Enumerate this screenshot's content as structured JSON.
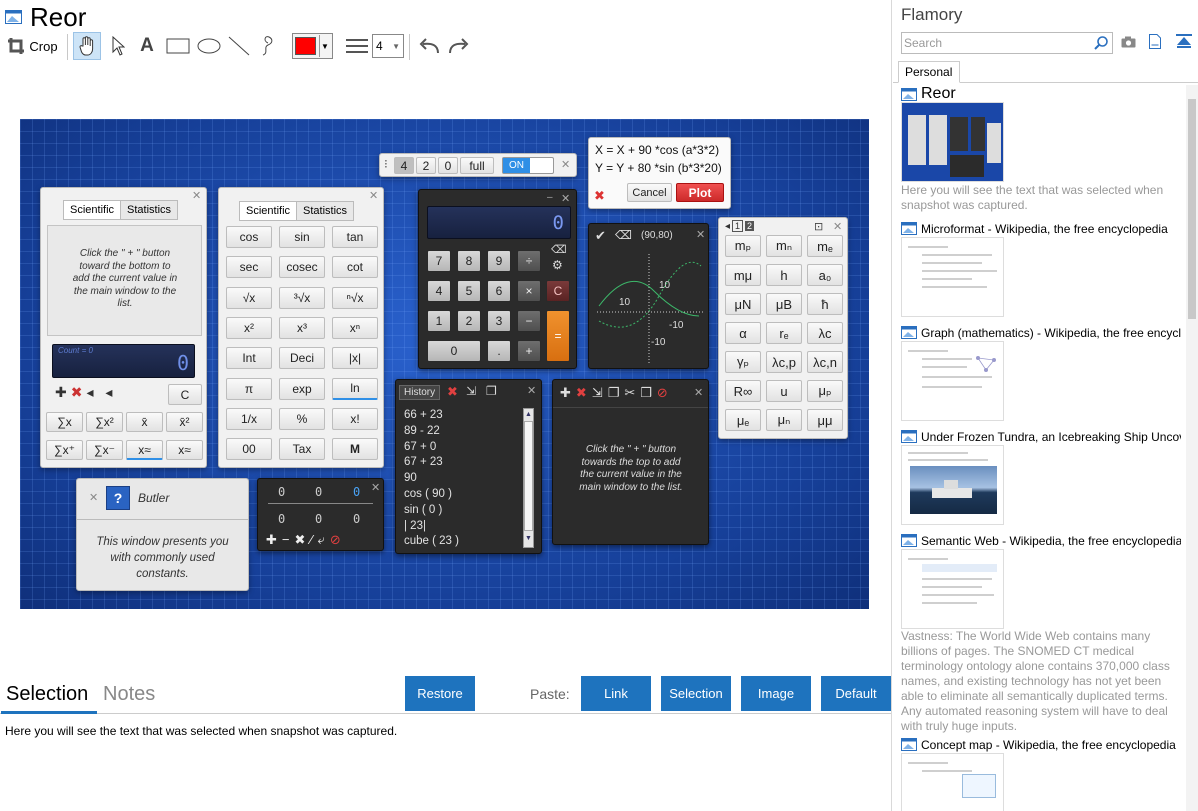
{
  "app": {
    "title": "Reor"
  },
  "toolbar": {
    "crop_label": "Crop",
    "line_width": "4",
    "color": "#ff0000"
  },
  "canvas": {
    "zoom_buttons": [
      "4",
      "2",
      "0",
      "full"
    ],
    "toggle": "ON",
    "sci_tabs": [
      "Scientific",
      "Statistics"
    ],
    "stats_hint": "Click the \" + \" button toward the bottom to add the current value in the main window to the list.",
    "count_label": "Count = 0",
    "lcd_value": "0",
    "stats_keys": [
      "C",
      "∑x",
      "∑x²",
      "x̄",
      "x̄²",
      "∑x⁺",
      "∑x⁻",
      "x≈",
      "x≈"
    ],
    "sci_keys": [
      "cos",
      "sin",
      "tan",
      "sec",
      "cosec",
      "cot",
      "√x",
      "³√x",
      "ⁿ√x",
      "x²",
      "x³",
      "xⁿ",
      "Int",
      "Deci",
      "|x|",
      "π",
      "exp",
      "ln",
      "1/x",
      "%",
      "x!",
      "00",
      "Tax",
      "M"
    ],
    "calc_keys": [
      "7",
      "8",
      "9",
      "÷",
      "4",
      "5",
      "6",
      "×",
      "C",
      "1",
      "2",
      "3",
      "−",
      "=",
      "0",
      ".",
      "+"
    ],
    "plot_eq1": "X = X + 90  *cos (a*3*2)",
    "plot_eq2": "Y = Y + 80  *sin (b*3*20)",
    "plot_cancel": "Cancel",
    "plot_button": "Plot",
    "graph_coords": "(90,80)",
    "graph_ticks": [
      "10",
      "10",
      "-10",
      "-10"
    ],
    "const_pages": [
      "1",
      "2"
    ],
    "const_keys": [
      "mₚ",
      "mₙ",
      "mₑ",
      "mμ",
      "h",
      "a₀",
      "μN",
      "μB",
      "ħ",
      "α",
      "rₑ",
      "λc",
      "γₚ",
      "λc,p",
      "λc,n",
      "R∞",
      "u",
      "μₚ",
      "μₑ",
      "μₙ",
      "μμ"
    ],
    "history_label": "History",
    "history_items": [
      "66 + 23",
      "89 - 22",
      "67 + 0",
      "67 + 23",
      "90",
      "cos ( 90 )",
      "sin ( 0 )",
      "| 23|",
      "cube ( 23 )"
    ],
    "list_hint": "Click the \" + \" button towards the top to add the current value in the main window to the list.",
    "butler_title": "Butler",
    "butler_text": "This window presents you with commonly used constants.",
    "memory_values": [
      "0",
      "0",
      "0",
      "0",
      "0",
      "0"
    ]
  },
  "bottom": {
    "tab_selection": "Selection",
    "tab_notes": "Notes",
    "restore": "Restore",
    "paste_label": "Paste:",
    "paste_buttons": [
      "Link",
      "Selection",
      "Image",
      "Default"
    ],
    "selection_text": "Here you will see the text that was selected when snapshot was captured."
  },
  "sidebar": {
    "title": "Flamory",
    "search_placeholder": "Search",
    "tab_personal": "Personal",
    "items": [
      {
        "title": "Reor",
        "desc": "Here you will see the text that was selected when snapshot was captured."
      },
      {
        "title": "Microformat - Wikipedia, the free encyclopedia"
      },
      {
        "title": "Graph (mathematics) - Wikipedia, the free encyclopedia"
      },
      {
        "title": "Under Frozen Tundra, an Icebreaking Ship Uncovers"
      },
      {
        "title": "Semantic Web - Wikipedia, the free encyclopedia",
        "desc": "Vastness: The World Wide Web contains many billions of pages. The SNOMED CT medical terminology ontology alone contains 370,000 class names, and existing technology has not yet been able to eliminate all semantically duplicated terms. Any automated reasoning system will have to deal with truly huge inputs."
      },
      {
        "title": "Concept map - Wikipedia, the free encyclopedia"
      }
    ]
  },
  "colors": {
    "accent": "#1e73be",
    "canvas_bg": "#1a47a8",
    "plot_red": "#e03030"
  }
}
